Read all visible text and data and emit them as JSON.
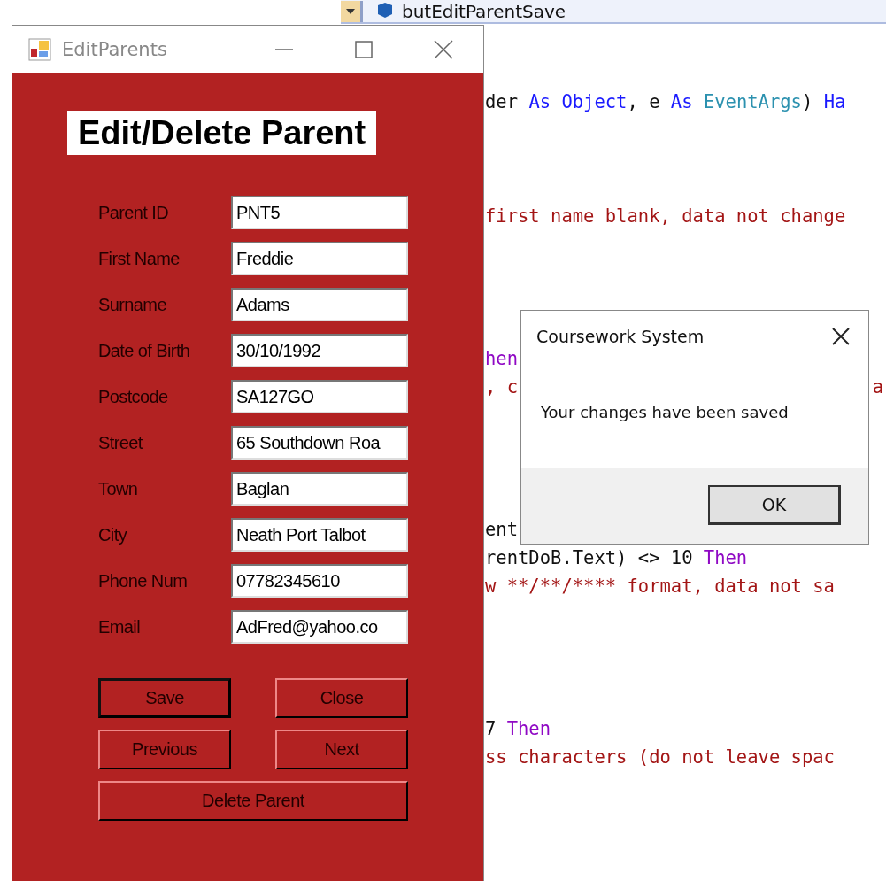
{
  "editor": {
    "member_dropdown": "butEditParentSave",
    "code_lines": [
      {
        "segments": [
          {
            "text": "der ",
            "kind": "plain"
          },
          {
            "text": "As ",
            "kind": "keyword"
          },
          {
            "text": "Object",
            "kind": "keyword"
          },
          {
            "text": ", e ",
            "kind": "plain"
          },
          {
            "text": "As ",
            "kind": "keyword"
          },
          {
            "text": "EventArgs",
            "kind": "type"
          },
          {
            "text": ") ",
            "kind": "plain"
          },
          {
            "text": "Ha",
            "kind": "keyword"
          }
        ]
      },
      {
        "kind": "blank"
      },
      {
        "kind": "blank"
      },
      {
        "kind": "blank"
      },
      {
        "segments": [
          {
            "text": "first name blank, data not change",
            "kind": "comment"
          }
        ]
      },
      {
        "kind": "blank"
      },
      {
        "kind": "blank"
      },
      {
        "kind": "blank"
      },
      {
        "kind": "blank"
      },
      {
        "segments": [
          {
            "text": "hen",
            "kind": "control"
          }
        ]
      },
      {
        "segments": [
          {
            "text": ", c",
            "kind": "comment"
          }
        ],
        "tail": {
          "text": "a",
          "kind": "comment"
        }
      },
      {
        "kind": "blank"
      },
      {
        "kind": "blank"
      },
      {
        "kind": "blank"
      },
      {
        "kind": "blank"
      },
      {
        "segments": [
          {
            "text": "ent",
            "kind": "plain"
          }
        ]
      },
      {
        "segments": [
          {
            "text": "rentDoB.Text) <> 10 ",
            "kind": "plain"
          },
          {
            "text": "Then",
            "kind": "control"
          }
        ]
      },
      {
        "segments": [
          {
            "text": "w **/**/**** format, data not sa",
            "kind": "comment"
          }
        ]
      },
      {
        "kind": "blank"
      },
      {
        "kind": "blank"
      },
      {
        "kind": "blank"
      },
      {
        "kind": "blank"
      },
      {
        "segments": [
          {
            "text": "7 ",
            "kind": "plain"
          },
          {
            "text": "Then",
            "kind": "control"
          }
        ]
      },
      {
        "segments": [
          {
            "text": "ss characters (do not leave spac",
            "kind": "comment"
          }
        ]
      }
    ]
  },
  "form": {
    "title": "EditParents",
    "heading": "Edit/Delete Parent",
    "fields": [
      {
        "label": "Parent ID",
        "value": "PNT5"
      },
      {
        "label": "First Name",
        "value": "Freddie"
      },
      {
        "label": "Surname",
        "value": "Adams"
      },
      {
        "label": "Date of Birth",
        "value": "30/10/1992"
      },
      {
        "label": "Postcode",
        "value": "SA127GO"
      },
      {
        "label": "Street",
        "value": "65 Southdown Roa"
      },
      {
        "label": "Town",
        "value": "Baglan"
      },
      {
        "label": "City",
        "value": "Neath Port Talbot"
      },
      {
        "label": "Phone Num",
        "value": "07782345610"
      },
      {
        "label": "Email",
        "value": "AdFred@yahoo.co"
      }
    ],
    "buttons": [
      {
        "label": "Save",
        "default": true,
        "wide": false
      },
      {
        "label": "Close",
        "default": false,
        "wide": false
      },
      {
        "label": "Previous",
        "default": false,
        "wide": false
      },
      {
        "label": "Next",
        "default": false,
        "wide": false
      },
      {
        "label": "Delete Parent",
        "default": false,
        "wide": true
      }
    ]
  },
  "dialog": {
    "title": "Coursework System",
    "message": "Your changes have been saved",
    "buttons": [
      {
        "label": "OK",
        "default": true
      }
    ]
  }
}
